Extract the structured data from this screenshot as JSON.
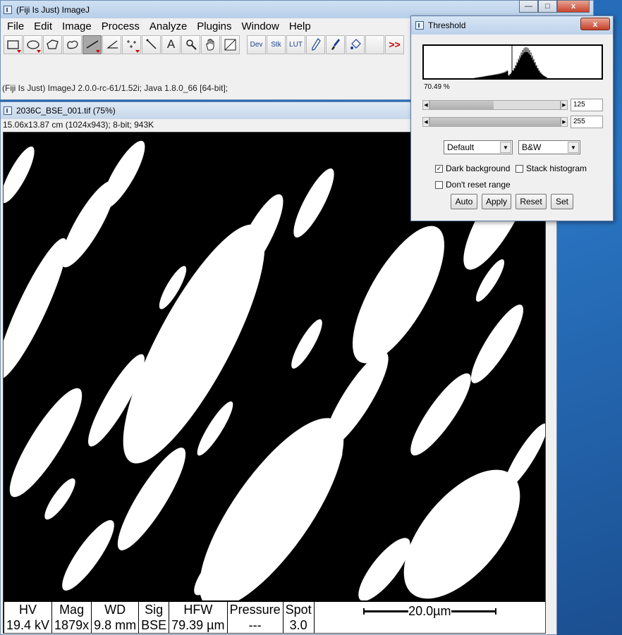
{
  "main_window": {
    "title": "(Fiji Is Just) ImageJ",
    "controls": {
      "minimize": "—",
      "maximize": "□",
      "close": "x"
    },
    "menu": [
      "File",
      "Edit",
      "Image",
      "Process",
      "Analyze",
      "Plugins",
      "Window",
      "Help"
    ],
    "toolbar_text": {
      "text_tool": "A",
      "dev": "Dev",
      "stk": "Stk",
      "lut": "LUT",
      "more": ">>"
    },
    "status": "(Fiji Is Just) ImageJ 2.0.0-rc-61/1.52i; Java 1.8.0_66 [64-bit];"
  },
  "image_window": {
    "title": "2036C_BSE_001.tif (75%)",
    "info": "15.06x13.87 cm (1024x943); 8-bit; 943K",
    "sem_bar": [
      {
        "label": "HV",
        "value": "19.4 kV"
      },
      {
        "label": "Mag",
        "value": "1879x"
      },
      {
        "label": "WD",
        "value": "9.8 mm"
      },
      {
        "label": "Sig",
        "value": "BSE"
      },
      {
        "label": "HFW",
        "value": "79.39 µm"
      },
      {
        "label": "Pressure",
        "value": "---"
      },
      {
        "label": "Spot",
        "value": "3.0"
      }
    ],
    "scale_bar": "20.0µm"
  },
  "threshold": {
    "title": "Threshold",
    "close": "x",
    "percent": "70.49 %",
    "lower_value": "125",
    "upper_value": "255",
    "lower_fraction": 0.49,
    "upper_fraction": 1.0,
    "method": "Default",
    "mode": "B&W",
    "dark_background": {
      "label": "Dark background",
      "checked": "✓"
    },
    "stack_histogram": {
      "label": "Stack histogram"
    },
    "dont_reset": {
      "label": "Don't reset range"
    },
    "buttons": {
      "auto": "Auto",
      "apply": "Apply",
      "reset": "Reset",
      "set": "Set"
    }
  }
}
